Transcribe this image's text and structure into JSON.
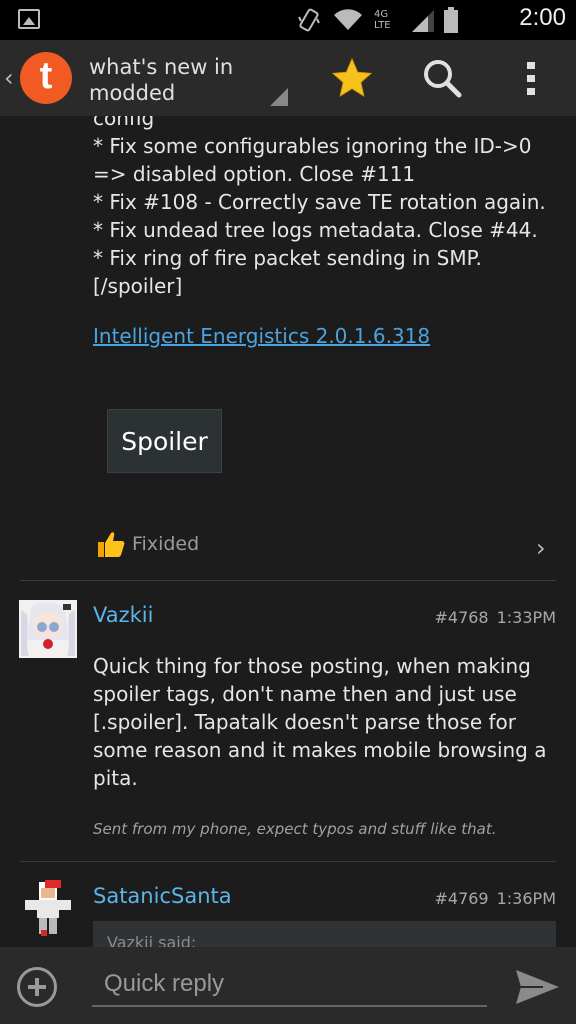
{
  "status_bar": {
    "time": "2:00",
    "network": "4G LTE"
  },
  "action_bar": {
    "title": "what's new in modded"
  },
  "post_prev": {
    "lines": [
      "config",
      "* Fix some configurables ignoring the ID->0",
      "=> disabled option. Close #111",
      "* Fix #108 - Correctly save TE rotation again.",
      "* Fix undead tree logs metadata. Close #44.",
      "* Fix ring of fire packet sending in SMP.",
      "[/spoiler]"
    ],
    "link": "Intelligent Energistics 2.0.1.6.318",
    "spoiler_button": "Spoiler",
    "thanks_label": "Fixided"
  },
  "posts": [
    {
      "username": "Vazkii",
      "number": "#4768",
      "time": "1:33PM",
      "body": "Quick thing for those posting, when making spoiler tags, don't name then and just use [.spoiler]. Tapatalk doesn't parse those for some reason and it makes mobile browsing a pita.",
      "signature": "Sent from my phone, expect typos and stuff like that."
    },
    {
      "username": "SatanicSanta",
      "number": "#4769",
      "time": "1:36PM",
      "quote_header": "Vazkii said:"
    }
  ],
  "reply_bar": {
    "placeholder": "Quick reply"
  },
  "colors": {
    "accent": "#f15a22",
    "link": "#4aa3df",
    "username": "#5cb4e8"
  }
}
